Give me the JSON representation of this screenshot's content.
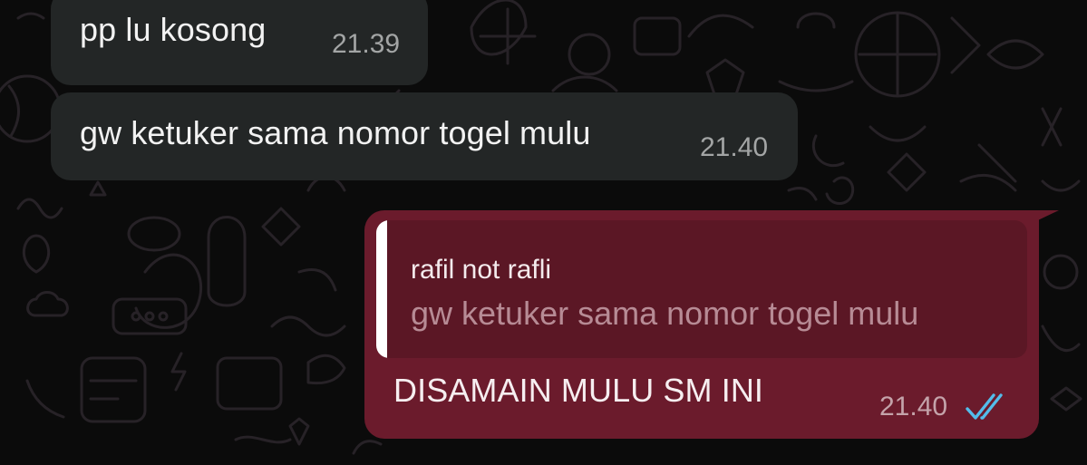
{
  "messages": [
    {
      "direction": "incoming",
      "text": "pp lu kosong",
      "time": "21.39"
    },
    {
      "direction": "incoming",
      "text": "gw ketuker sama nomor togel mulu",
      "time": "21.40"
    },
    {
      "direction": "outgoing",
      "reply": {
        "author": "rafil not rafli",
        "text": "gw ketuker sama nomor togel mulu"
      },
      "text": "DISAMAIN MULU SM INI",
      "time": "21.40",
      "status_icon": "double-check-read-icon"
    }
  ],
  "colors": {
    "background": "#0b0b0b",
    "incoming_bubble": "#232626",
    "outgoing_bubble": "#6b1b2c",
    "quote_bg": "#5b1725",
    "read_ticks": "#53bdeb"
  }
}
